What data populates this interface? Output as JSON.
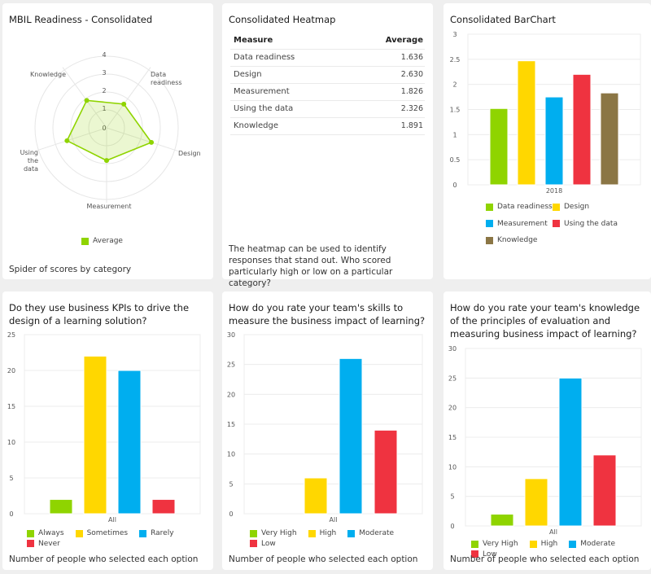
{
  "colors": {
    "green": "#8fd400",
    "yellow": "#ffd700",
    "blue": "#00aeef",
    "red": "#ef3340",
    "brown": "#8b7645",
    "grid": "#ececec",
    "axis_text": "#555555"
  },
  "cards": {
    "radar": {
      "title": "MBIL Readiness - Consolidated",
      "footer": "Spider of scores by category"
    },
    "heatmap": {
      "title": "Consolidated Heatmap",
      "columns": [
        "Measure",
        "Average"
      ],
      "rows": [
        {
          "measure": "Data readiness",
          "average": "1.636"
        },
        {
          "measure": "Design",
          "average": "2.630"
        },
        {
          "measure": "Measurement",
          "average": "1.826"
        },
        {
          "measure": "Using the data",
          "average": "2.326"
        },
        {
          "measure": "Knowledge",
          "average": "1.891"
        }
      ],
      "footer": "The heatmap can be used to identify responses that stand out. Who scored particularly high or low on a particular category?"
    },
    "barchart": {
      "title": "Consolidated BarChart"
    },
    "kpi": {
      "title": "Do they use business KPIs to drive the design of a learning solution?",
      "footer": "Number of people who selected each option"
    },
    "skills": {
      "title": "How do you rate your team's skills to measure the business impact of learning?",
      "footer": "Number of people who selected each option"
    },
    "knowledge": {
      "title": "How do you rate your team's knowledge of the principles of evaluation and measuring business impact of learning?",
      "footer": "Number of people who selected each option"
    }
  },
  "chart_data": [
    {
      "id": "radar",
      "type": "radar",
      "title": "MBIL Readiness - Consolidated",
      "axes": [
        [
          "Data",
          "readiness"
        ],
        [
          "Design"
        ],
        [
          "Measurement"
        ],
        [
          "Using",
          "the",
          "data"
        ],
        [
          "Knowledge"
        ]
      ],
      "categories": [
        "Data readiness",
        "Design",
        "Measurement",
        "Using the data",
        "Knowledge"
      ],
      "series": [
        {
          "name": "Average",
          "color": "#8fd400",
          "values": [
            1.636,
            2.63,
            1.826,
            2.326,
            1.891
          ]
        }
      ],
      "rlim": [
        0,
        4
      ],
      "ticks": [
        "0",
        "1",
        "2",
        "3",
        "4"
      ],
      "legend": "bottom"
    },
    {
      "id": "barchart",
      "type": "bar",
      "title": "Consolidated BarChart",
      "categories": [
        "2018"
      ],
      "series": [
        {
          "name": "Data readiness",
          "color": "#8fd400",
          "values": [
            1.52
          ]
        },
        {
          "name": "Design",
          "color": "#ffd700",
          "values": [
            2.47
          ]
        },
        {
          "name": "Measurement",
          "color": "#00aeef",
          "values": [
            1.75
          ]
        },
        {
          "name": "Using the data",
          "color": "#ef3340",
          "values": [
            2.2
          ]
        },
        {
          "name": "Knowledge",
          "color": "#8b7645",
          "values": [
            1.83
          ]
        }
      ],
      "ylim": [
        0,
        3
      ],
      "yticks": [
        "0",
        "0.5",
        "1",
        "1.5",
        "2",
        "2.5",
        "3"
      ],
      "ytick_values": [
        0,
        0.5,
        1,
        1.5,
        2,
        2.5,
        3
      ],
      "grid": true,
      "legend": "bottom"
    },
    {
      "id": "kpi",
      "type": "bar",
      "title": "Do they use business KPIs to drive the design of a learning solution?",
      "categories": [
        "All"
      ],
      "series": [
        {
          "name": "Always",
          "color": "#8fd400",
          "values": [
            2
          ]
        },
        {
          "name": "Sometimes",
          "color": "#ffd700",
          "values": [
            22
          ]
        },
        {
          "name": "Rarely",
          "color": "#00aeef",
          "values": [
            20
          ]
        },
        {
          "name": "Never",
          "color": "#ef3340",
          "values": [
            2
          ]
        }
      ],
      "ylim": [
        0,
        25
      ],
      "yticks": [
        "0",
        "5",
        "10",
        "15",
        "20",
        "25"
      ],
      "ytick_values": [
        0,
        5,
        10,
        15,
        20,
        25
      ],
      "grid": true,
      "legend": "bottom"
    },
    {
      "id": "skills",
      "type": "bar",
      "title": "How do you rate your team's skills to measure the business impact of learning?",
      "categories": [
        "All"
      ],
      "series": [
        {
          "name": "Very High",
          "color": "#8fd400",
          "values": [
            0
          ]
        },
        {
          "name": "High",
          "color": "#ffd700",
          "values": [
            6
          ]
        },
        {
          "name": "Moderate",
          "color": "#00aeef",
          "values": [
            26
          ]
        },
        {
          "name": "Low",
          "color": "#ef3340",
          "values": [
            14
          ]
        }
      ],
      "ylim": [
        0,
        30
      ],
      "yticks": [
        "0",
        "5",
        "10",
        "15",
        "20",
        "25",
        "30"
      ],
      "ytick_values": [
        0,
        5,
        10,
        15,
        20,
        25,
        30
      ],
      "grid": true,
      "legend": "bottom"
    },
    {
      "id": "knowledge",
      "type": "bar",
      "title": "How do you rate your team's knowledge of the principles of evaluation and measuring business impact of learning?",
      "categories": [
        "All"
      ],
      "series": [
        {
          "name": "Very High",
          "color": "#8fd400",
          "values": [
            2
          ]
        },
        {
          "name": "High",
          "color": "#ffd700",
          "values": [
            8
          ]
        },
        {
          "name": "Moderate",
          "color": "#00aeef",
          "values": [
            25
          ]
        },
        {
          "name": "Low",
          "color": "#ef3340",
          "values": [
            12
          ]
        }
      ],
      "ylim": [
        0,
        30
      ],
      "yticks": [
        "0",
        "5",
        "10",
        "15",
        "20",
        "25",
        "30"
      ],
      "ytick_values": [
        0,
        5,
        10,
        15,
        20,
        25,
        30
      ],
      "grid": true,
      "legend": "bottom"
    }
  ]
}
